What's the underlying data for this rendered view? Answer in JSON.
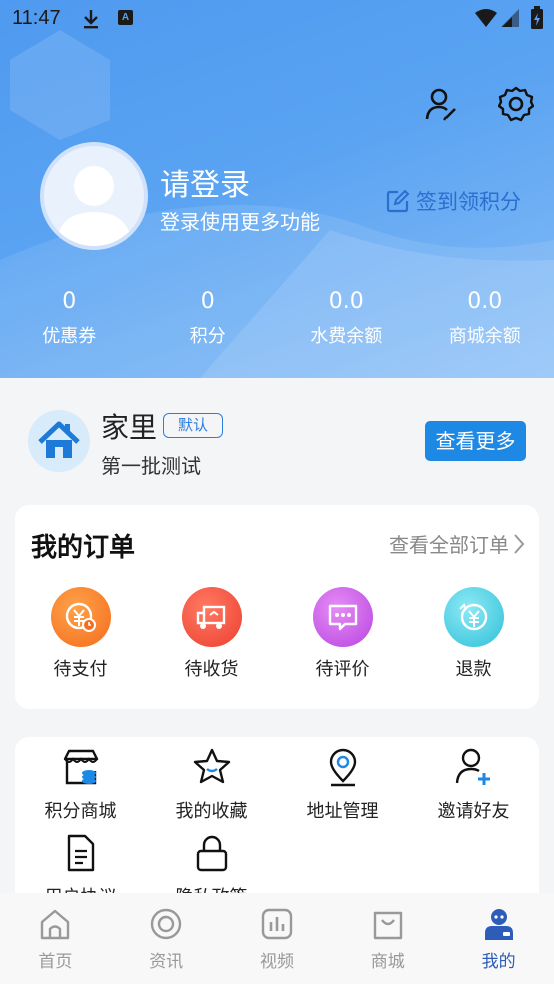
{
  "status_bar": {
    "time": "11:47"
  },
  "profile": {
    "title": "请登录",
    "subtitle": "登录使用更多功能",
    "signin_label": "签到领积分"
  },
  "stats": [
    {
      "value": "0",
      "label": "优惠券"
    },
    {
      "value": "0",
      "label": "积分"
    },
    {
      "value": "0.0",
      "label": "水费余额"
    },
    {
      "value": "0.0",
      "label": "商城余额"
    }
  ],
  "home": {
    "name": "家里",
    "badge": "默认",
    "subtitle": "第一批测试",
    "view_more": "查看更多"
  },
  "orders": {
    "title": "我的订单",
    "all_label": "查看全部订单",
    "items": [
      {
        "label": "待支付",
        "icon": "pending-payment-icon",
        "color": "#f57c28"
      },
      {
        "label": "待收货",
        "icon": "truck-icon",
        "color": "#f0503c"
      },
      {
        "label": "待评价",
        "icon": "chat-icon",
        "color": "#c95ee8"
      },
      {
        "label": "退款",
        "icon": "refund-icon",
        "color": "#3fc8dc"
      }
    ]
  },
  "tools": [
    {
      "label": "积分商城",
      "icon": "points-store-icon"
    },
    {
      "label": "我的收藏",
      "icon": "star-icon"
    },
    {
      "label": "地址管理",
      "icon": "location-pin-icon"
    },
    {
      "label": "邀请好友",
      "icon": "invite-friend-icon"
    },
    {
      "label": "用户协议",
      "icon": "document-icon"
    },
    {
      "label": "隐私政策",
      "icon": "lock-icon"
    }
  ],
  "nav": [
    {
      "label": "首页",
      "icon": "home-icon",
      "active": false
    },
    {
      "label": "资讯",
      "icon": "news-icon",
      "active": false
    },
    {
      "label": "视频",
      "icon": "video-icon",
      "active": false
    },
    {
      "label": "商城",
      "icon": "shopping-bag-icon",
      "active": false
    },
    {
      "label": "我的",
      "icon": "profile-icon",
      "active": true
    }
  ],
  "colors": {
    "header": "#5aa3f2",
    "accent": "#1e88e5",
    "nav_active": "#2d5db8"
  }
}
